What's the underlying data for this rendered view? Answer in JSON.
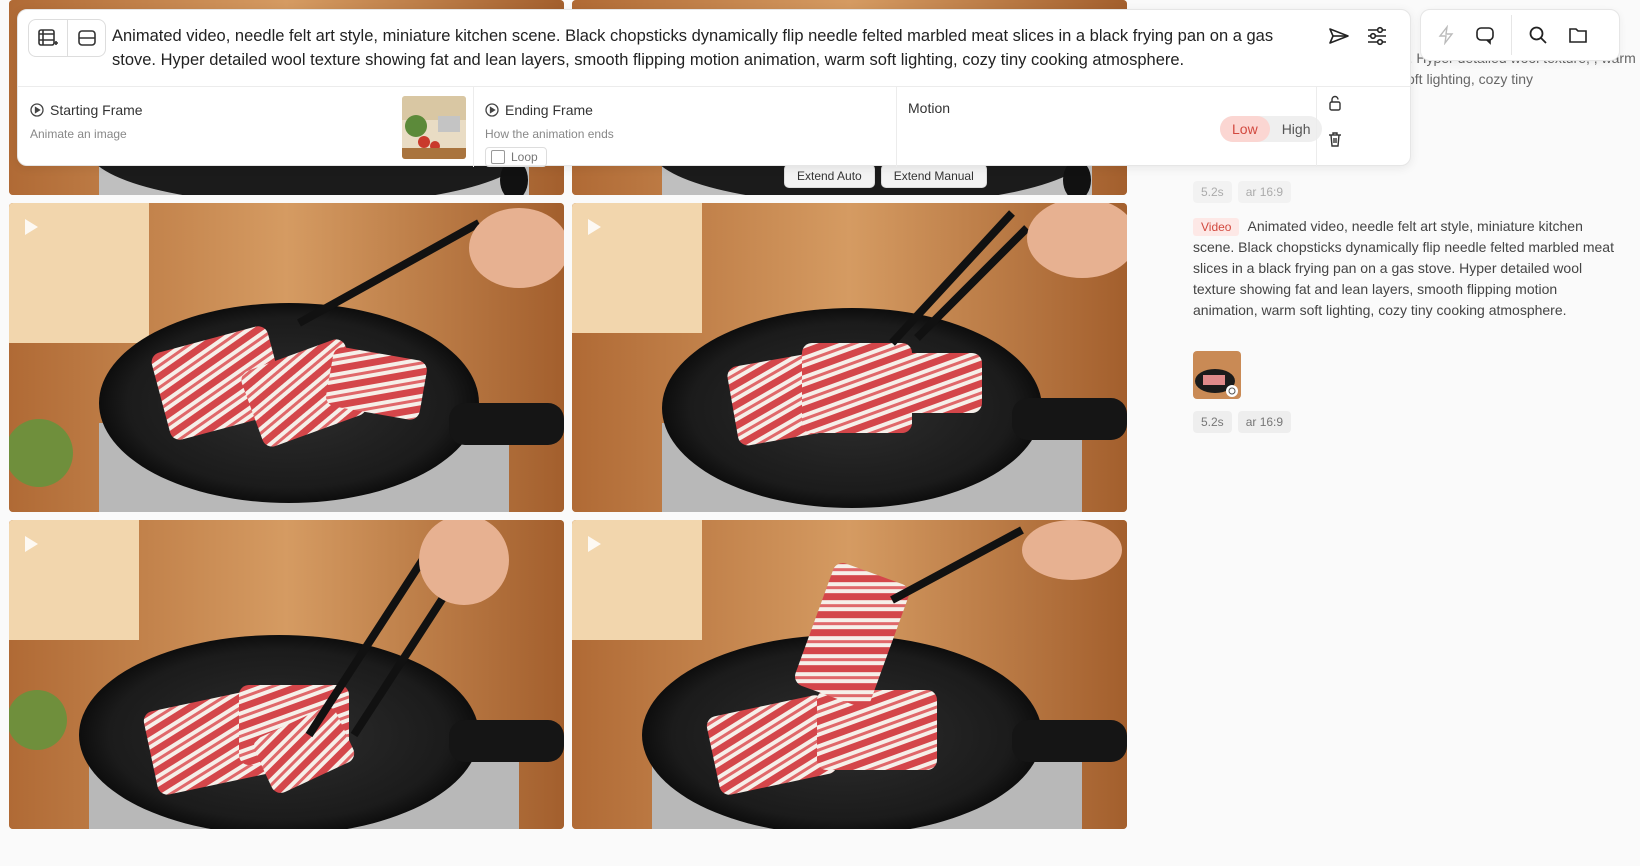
{
  "prompt": {
    "text": "Animated video, needle felt art style, miniature kitchen scene. Black chopsticks dynamically flip needle felted marbled meat slices in a black frying pan on a gas stove. Hyper detailed wool texture showing fat and lean layers, smooth flipping motion animation, warm soft lighting, cozy tiny cooking atmosphere."
  },
  "starting_frame": {
    "title": "Starting Frame",
    "subtitle": "Animate an image"
  },
  "ending_frame": {
    "title": "Ending Frame",
    "subtitle": "How the animation ends",
    "loop_label": "Loop"
  },
  "motion": {
    "title": "Motion",
    "low": "Low",
    "high": "High",
    "selected": "Low"
  },
  "extend": {
    "auto": "Extend Auto",
    "manual": "Extend Manual"
  },
  "history": {
    "faded_text": "t). Hyper detailed wool texture, , warm soft lighting, cozy tiny",
    "chips_top": [
      "5.2s",
      "ar 16:9"
    ],
    "badge": "Video",
    "entry_text": "Animated video, needle felt art style, miniature kitchen scene. Black chopsticks dynamically flip needle felted marbled meat slices in a black frying pan on a gas stove. Hyper detailed wool texture showing fat and lean layers, smooth flipping motion animation, warm soft lighting, cozy tiny cooking atmosphere.",
    "chips": [
      "5.2s",
      "ar 16:9"
    ]
  },
  "icons": {
    "new_frame": "add-frame-icon",
    "frame_toggle": "frame-toggle-icon",
    "send": "send-icon",
    "settings": "sliders-icon",
    "lock": "unlock-icon",
    "trash": "trash-icon",
    "flash": "bolt-icon",
    "chat": "chat-icon",
    "search": "search-icon",
    "folder": "folder-icon"
  },
  "colors": {
    "accent": "#d2493f",
    "accent_bg": "#fbd6d2"
  }
}
